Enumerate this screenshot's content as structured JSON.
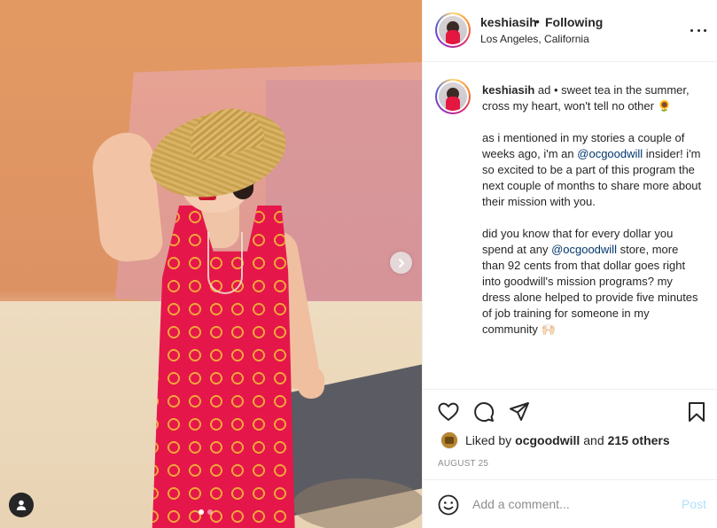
{
  "post": {
    "username": "keshiasih",
    "separator": "•",
    "follow_status": "Following",
    "location": "Los Angeles, California",
    "carousel_slides": 2,
    "current_slide": 1
  },
  "caption": {
    "username": "keshiasih",
    "paragraph1": " ad • sweet tea in the summer, cross my heart, won't tell no other 🌻",
    "p2_before": "as i mentioned in my stories a couple of weeks ago, i'm an ",
    "p2_mention": "@ocgoodwill",
    "p2_after": " insider! i'm so excited to be a part of this program the next couple of months to share more about their mission with you.",
    "p3_before": "did you know that for every dollar you spend at any ",
    "p3_mention": "@ocgoodwill",
    "p3_after": " store, more than 92 cents from that dollar goes right into goodwill's mission programs? my dress alone helped to provide five minutes of job training for someone in my community 🙌🏻"
  },
  "likes": {
    "prefix": "Liked by",
    "liker": "ocgoodwill",
    "and": "and",
    "others": "215 others"
  },
  "date": "AUGUST 25",
  "comment": {
    "placeholder": "Add a comment...",
    "post_label": "Post"
  },
  "icons": {
    "like": "heart-icon",
    "comment": "comment-icon",
    "share": "paper-plane-icon",
    "save": "bookmark-icon",
    "emoji": "smiley-icon",
    "more": "more-options-icon",
    "next": "chevron-right-icon",
    "tags": "user-tag-icon"
  },
  "colors": {
    "mention": "#00376b",
    "post_disabled": "#b2dffc",
    "secondary_text": "#8e8e8e"
  }
}
